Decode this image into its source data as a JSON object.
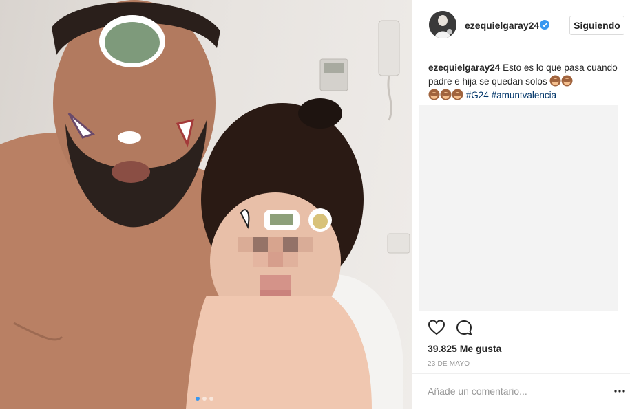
{
  "post": {
    "username": "ezequielgaray24",
    "follow_label": "Siguiendo",
    "caption_user": "ezequielgaray24",
    "caption_text": "Esto es lo que pasa cuando padre e hija se quedan solos",
    "hashtags": [
      "#G24",
      "#amuntvalencia"
    ],
    "likes": "39.825 Me gusta",
    "date": "23 DE MAYO",
    "comment_placeholder": "Añade un comentario...",
    "carousel": {
      "total": 3,
      "active": 1
    }
  },
  "icons": {
    "verified": "verified-badge-icon",
    "like": "heart-icon",
    "comment": "comment-bubble-icon",
    "more": "more-options-icon",
    "emoji": "see-no-evil-monkey-emoji"
  },
  "colors": {
    "accent": "#3897f0",
    "hashtag": "#003569",
    "text": "#262626",
    "muted": "#999999"
  }
}
